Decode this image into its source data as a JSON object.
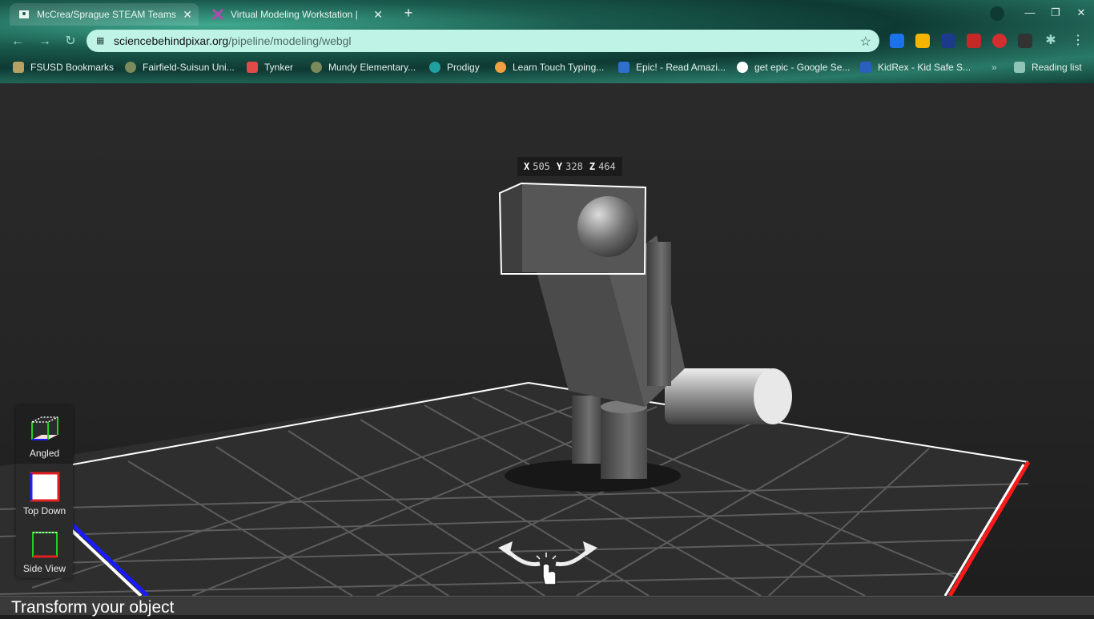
{
  "browser": {
    "tabs": [
      {
        "title": "McCrea/Sprague STEAM Teams",
        "active": true
      },
      {
        "title": "Virtual Modeling Workstation |",
        "active": false
      }
    ],
    "address": {
      "host": "sciencebehindpixar.org",
      "path": "/pipeline/modeling/webgl"
    },
    "bookmarks": [
      "FSUSD Bookmarks",
      "Fairfield-Suisun Uni...",
      "Tynker",
      "Mundy Elementary...",
      "Prodigy",
      "Learn Touch Typing...",
      "Epic! - Read Amazi...",
      "get epic - Google Se...",
      "KidRex - Kid Safe S..."
    ],
    "reading_list": "Reading list"
  },
  "viewport": {
    "coords": {
      "x_label": "X",
      "x": "505",
      "y_label": "Y",
      "y": "328",
      "z_label": "Z",
      "z": "464"
    },
    "views": [
      {
        "label": "Angled",
        "active": true
      },
      {
        "label": "Top Down",
        "active": false
      },
      {
        "label": "Side View",
        "active": false
      }
    ]
  },
  "footer": {
    "title": "Transform your object"
  },
  "colors": {
    "x_axis": "#ff1a1a",
    "z_axis": "#1a1aff",
    "accent": "#bff3e6"
  }
}
